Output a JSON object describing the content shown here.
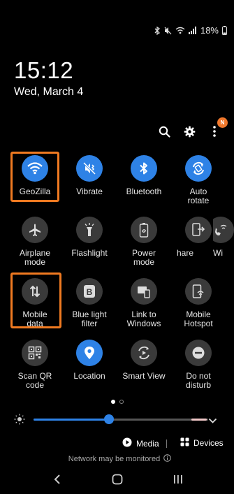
{
  "status_bar": {
    "battery": "18%"
  },
  "clock": {
    "time": "15:12",
    "date": "Wed, March 4"
  },
  "top_actions": {
    "notification_badge": "N"
  },
  "tiles": [
    {
      "label": "GeoZilla",
      "icon": "wifi-icon",
      "active": true
    },
    {
      "label": "Vibrate",
      "icon": "vibrate-icon",
      "active": true
    },
    {
      "label": "Bluetooth",
      "icon": "bluetooth-icon",
      "active": true
    },
    {
      "label": "Auto\nrotate",
      "icon": "rotate-icon",
      "active": true
    },
    {
      "label": "Airplane\nmode",
      "icon": "airplane-icon",
      "active": false
    },
    {
      "label": "Flashlight",
      "icon": "flashlight-icon",
      "active": false
    },
    {
      "label": "Power\nmode",
      "icon": "power-mode-icon",
      "active": false
    },
    {
      "label": "hare",
      "icon": "share-icon",
      "active": false
    },
    {
      "label": "Wi",
      "icon": "wifi-calling-icon",
      "active": false
    },
    {
      "label": "Mobile\ndata",
      "icon": "mobile-data-icon",
      "active": false
    },
    {
      "label": "Blue light\nfilter",
      "icon": "blue-light-icon",
      "active": false
    },
    {
      "label": "Link to\nWindows",
      "icon": "link-windows-icon",
      "active": false
    },
    {
      "label": "Mobile\nHotspot",
      "icon": "hotspot-icon",
      "active": false
    },
    {
      "label": "Scan QR\ncode",
      "icon": "qr-code-icon",
      "active": false
    },
    {
      "label": "Location",
      "icon": "location-icon",
      "active": true
    },
    {
      "label": "Smart View",
      "icon": "smart-view-icon",
      "active": false
    },
    {
      "label": "Do not\ndisturb",
      "icon": "do-not-disturb-icon",
      "active": false
    }
  ],
  "brightness": {
    "level": 0.43
  },
  "media": {
    "media_label": "Media",
    "devices_label": "Devices"
  },
  "network_notice": "Network may be monitored",
  "colors": {
    "accent": "#2e82e6",
    "highlight": "#f07a21",
    "tile_off": "#3a3a3a"
  }
}
